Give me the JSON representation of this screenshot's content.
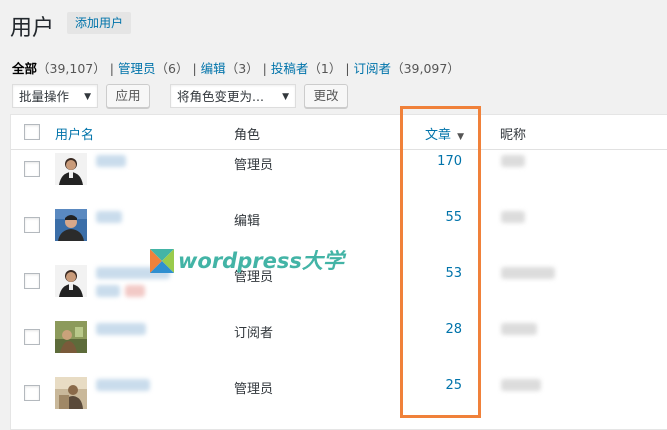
{
  "page": {
    "title": "用户",
    "add_new": "添加用户"
  },
  "filters": [
    {
      "label": "全部",
      "count": "（39,107）",
      "current": true
    },
    {
      "label": "管理员",
      "count": "（6）"
    },
    {
      "label": "编辑",
      "count": "（3）"
    },
    {
      "label": "投稿者",
      "count": "（1）"
    },
    {
      "label": "订阅者",
      "count": "（39,097）"
    }
  ],
  "toolbar": {
    "bulk_select": "批量操作",
    "apply": "应用",
    "role_select": "将角色变更为...",
    "change": "更改"
  },
  "columns": {
    "username": "用户名",
    "role": "角色",
    "posts": "文章",
    "sort_icon": "▼",
    "nickname": "昵称"
  },
  "rows": [
    {
      "role": "管理员",
      "posts": "170",
      "avatar": "person-icon"
    },
    {
      "role": "编辑",
      "posts": "55",
      "avatar": "person-icon"
    },
    {
      "role": "管理员",
      "posts": "53",
      "avatar": "person-icon"
    },
    {
      "role": "订阅者",
      "posts": "28",
      "avatar": "photo"
    },
    {
      "role": "管理员",
      "posts": "25",
      "avatar": "photo"
    }
  ],
  "watermark": {
    "text": "wordpress大学"
  },
  "colors": {
    "link": "#0073aa",
    "highlight": "#f0813a",
    "watermark": "#43b4a6"
  }
}
